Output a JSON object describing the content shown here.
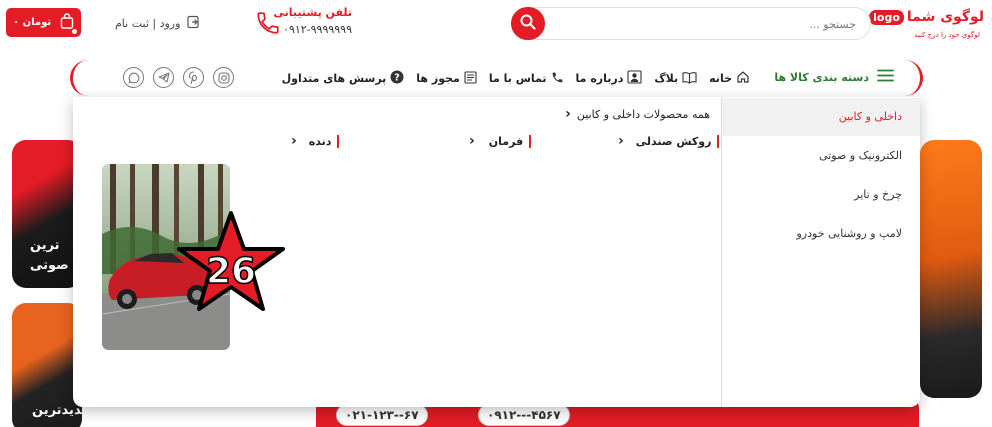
{
  "header": {
    "logo": {
      "main": "لوگوی شما",
      "badge": "logo",
      "sub": "لوگوی خود را درج کنید"
    },
    "search": {
      "placeholder": "جستجو ..."
    },
    "support": {
      "title": "تلفن پشتیبانی",
      "phone": "۰۹۱۲-۹۹۹۹۹۹۹"
    },
    "login": {
      "label": "ورود | ثبت نام"
    },
    "cart": {
      "label": "۰ تومان"
    }
  },
  "nav": {
    "categories_label": "دسته بندی کالا ها",
    "links": [
      {
        "label": "خانه",
        "icon": "home-icon"
      },
      {
        "label": "بلاگ",
        "icon": "book-icon"
      },
      {
        "label": "درباره ما",
        "icon": "user-icon"
      },
      {
        "label": "تماس با ما",
        "icon": "phone-icon"
      },
      {
        "label": "مجوز ها",
        "icon": "document-icon"
      },
      {
        "label": "پرسش های متداول",
        "icon": "question-icon"
      }
    ],
    "socials": [
      "instagram-icon",
      "pinterest-icon",
      "telegram-icon",
      "whatsapp-icon"
    ]
  },
  "mega_menu": {
    "categories": [
      {
        "label": "داخلی و کابین",
        "active": true
      },
      {
        "label": "الکترونیک و صوتی",
        "active": false
      },
      {
        "label": "چرخ و تایر",
        "active": false
      },
      {
        "label": "لامپ و روشنایی خودرو",
        "active": false
      }
    ],
    "all_products_label": "همه محصولات داخلی و کابین",
    "subcategories": [
      "روکش صندلی",
      "فرمان",
      "دنده"
    ],
    "promo": {
      "badge": "26"
    }
  },
  "background": {
    "card1_lines": [
      "ترین",
      "ستم صوتی"
    ],
    "card2_line": "جدیدترین",
    "phones": [
      "۰۲۱-۱۲۳--۶۷",
      "۰۹۱۲---۴۵۶۷"
    ]
  },
  "colors": {
    "accent": "#e31c25",
    "category_text": "#2e7d32"
  }
}
